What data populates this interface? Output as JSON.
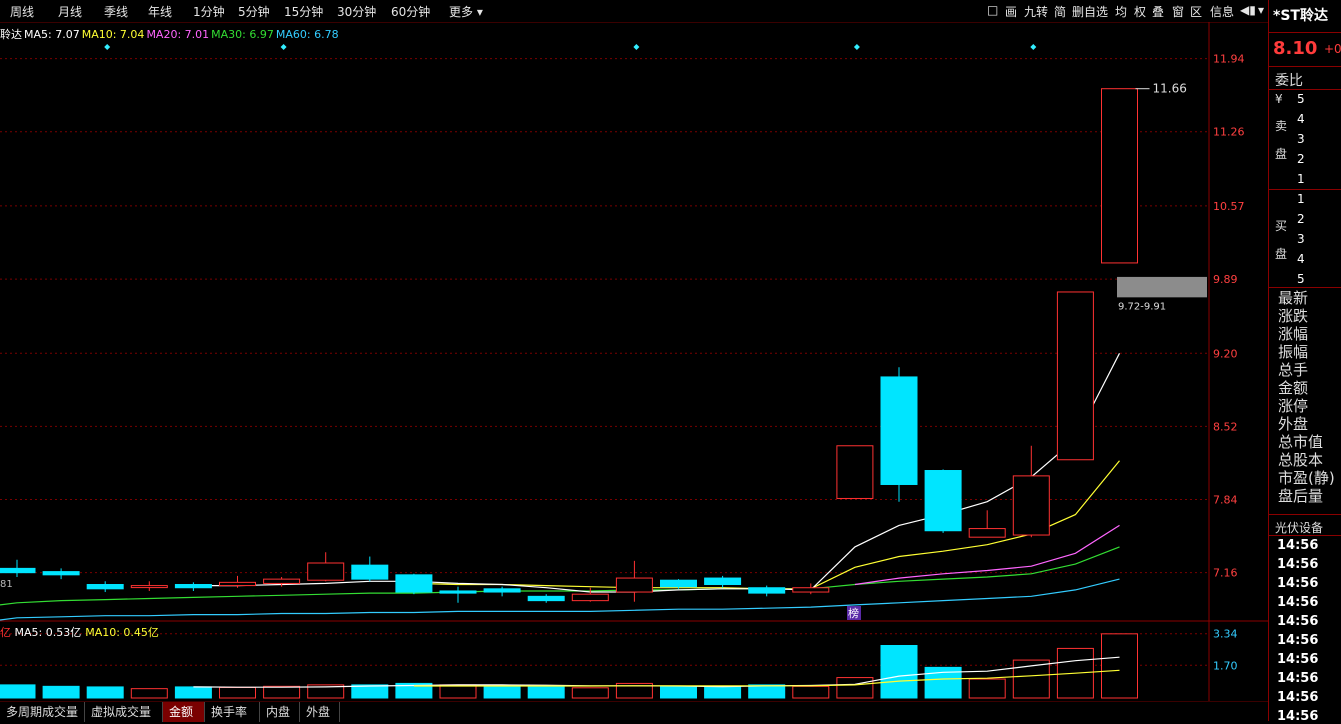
{
  "toolbar": {
    "periods": [
      "周线",
      "月线",
      "季线",
      "年线",
      "1分钟",
      "5分钟",
      "15分钟",
      "30分钟",
      "60分钟",
      "更多"
    ],
    "icons": [
      "□",
      "画",
      "九转",
      "简",
      "删自选",
      "均",
      "权",
      "叠",
      "窗",
      "区",
      "信息",
      "◀▮",
      "▾"
    ]
  },
  "ma_legend": {
    "name": "聆达",
    "items": [
      {
        "label": "MA5: 7.07",
        "color": "#ffffff"
      },
      {
        "label": "MA10: 7.04",
        "color": "#ffff33"
      },
      {
        "label": "MA20: 7.01",
        "color": "#ff66ff"
      },
      {
        "label": "MA30: 6.97",
        "color": "#33dd33"
      },
      {
        "label": "MA60: 6.78",
        "color": "#33ccff"
      }
    ]
  },
  "price_axis": {
    "ticks": [
      "11.94",
      "11.26",
      "10.57",
      "9.89",
      "9.20",
      "8.52",
      "7.84",
      "7.16"
    ]
  },
  "annotations": {
    "high_label": "11.66",
    "range_label": "9.72-9.91",
    "left_edge_label": "81",
    "bang_marker": "榜"
  },
  "volume": {
    "legend_prefix": "亿",
    "items": [
      {
        "label": "MA5: 0.53亿",
        "color": "#ffffff"
      },
      {
        "label": "MA10: 0.45亿",
        "color": "#ffff33"
      }
    ],
    "axis_ticks": [
      "3.34",
      "1.70"
    ]
  },
  "tabs": [
    {
      "label": "多周期成交量",
      "active": false
    },
    {
      "label": "虚拟成交量",
      "active": false
    },
    {
      "label": "金额",
      "active": true
    },
    {
      "label": "换手率",
      "active": false
    },
    {
      "label": "内盘",
      "active": false
    },
    {
      "label": "外盘",
      "active": false
    }
  ],
  "right_panel": {
    "title": "*ST聆达",
    "price": "8.10",
    "change": "+0",
    "weibi": "委比",
    "yen": "¥",
    "sell_chars": [
      "卖",
      "盘"
    ],
    "sell_levels": [
      "5",
      "4",
      "3",
      "2",
      "1"
    ],
    "buy_chars": [
      "买",
      "盘"
    ],
    "buy_levels": [
      "1",
      "2",
      "3",
      "4",
      "5"
    ],
    "fields": [
      "最新",
      "涨跌",
      "涨幅",
      "振幅",
      "总手",
      "金额",
      "涨停",
      "外盘",
      "总市值",
      "总股本",
      "市盈(静)",
      "盘后量"
    ],
    "sector": "光伏设备",
    "times": [
      "14:56",
      "14:56",
      "14:56",
      "14:56",
      "14:56",
      "14:56",
      "14:56",
      "14:56",
      "14:56",
      "14:56"
    ]
  },
  "chart_data": {
    "type": "candlestick",
    "colors": {
      "up": "#ff3232",
      "down": "#00e5ff",
      "ma5": "#ffffff",
      "ma10": "#ffff33",
      "ma20": "#ff66ff",
      "ma30": "#33dd33",
      "ma60": "#33ccff",
      "grid": "#7a0000"
    },
    "candles": [
      {
        "open": 7.2,
        "close": 7.16,
        "high": 7.28,
        "low": 7.12
      },
      {
        "open": 7.17,
        "close": 7.14,
        "high": 7.2,
        "low": 7.1
      },
      {
        "open": 7.05,
        "close": 7.01,
        "high": 7.08,
        "low": 6.98
      },
      {
        "open": 7.03,
        "close": 7.04,
        "high": 7.08,
        "low": 6.99
      },
      {
        "open": 7.05,
        "close": 7.02,
        "high": 7.07,
        "low": 6.99
      },
      {
        "open": 7.04,
        "close": 7.07,
        "high": 7.13,
        "low": 7.02
      },
      {
        "open": 7.06,
        "close": 7.1,
        "high": 7.12,
        "low": 7.03
      },
      {
        "open": 7.09,
        "close": 7.25,
        "high": 7.35,
        "low": 7.08
      },
      {
        "open": 7.23,
        "close": 7.1,
        "high": 7.31,
        "low": 7.08
      },
      {
        "open": 7.14,
        "close": 6.98,
        "high": 7.15,
        "low": 6.96
      },
      {
        "open": 6.99,
        "close": 6.97,
        "high": 7.03,
        "low": 6.88
      },
      {
        "open": 7.01,
        "close": 6.98,
        "high": 7.03,
        "low": 6.94
      },
      {
        "open": 6.94,
        "close": 6.9,
        "high": 6.96,
        "low": 6.88
      },
      {
        "open": 6.9,
        "close": 6.96,
        "high": 7.02,
        "low": 6.89
      },
      {
        "open": 6.98,
        "close": 7.11,
        "high": 7.27,
        "low": 6.89
      },
      {
        "open": 7.09,
        "close": 7.03,
        "high": 7.1,
        "low": 7.01
      },
      {
        "open": 7.11,
        "close": 7.05,
        "high": 7.13,
        "low": 7.02
      },
      {
        "open": 7.02,
        "close": 6.97,
        "high": 7.04,
        "low": 6.94
      },
      {
        "open": 6.98,
        "close": 7.02,
        "high": 7.06,
        "low": 6.96
      },
      {
        "open": 7.85,
        "close": 8.34,
        "high": 8.34,
        "low": 7.85
      },
      {
        "open": 8.98,
        "close": 7.98,
        "high": 9.07,
        "low": 7.82
      },
      {
        "open": 8.11,
        "close": 7.55,
        "high": 8.12,
        "low": 7.53
      },
      {
        "open": 7.49,
        "close": 7.57,
        "high": 7.74,
        "low": 7.49
      },
      {
        "open": 7.51,
        "close": 8.06,
        "high": 8.34,
        "low": 7.49
      },
      {
        "open": 8.21,
        "close": 9.77,
        "high": 9.77,
        "low": 8.21
      },
      {
        "open": 10.04,
        "close": 11.66,
        "high": 11.66,
        "low": 10.04
      }
    ],
    "ma": {
      "ma5": [
        null,
        null,
        null,
        null,
        7.04,
        7.04,
        7.05,
        7.06,
        7.08,
        7.08,
        7.06,
        7.05,
        7.02,
        6.98,
        6.98,
        7.0,
        7.01,
        7.01,
        7.0,
        7.4,
        7.6,
        7.7,
        7.82,
        8.05,
        8.4,
        9.2
      ],
      "ma10": [
        null,
        null,
        null,
        null,
        null,
        null,
        null,
        null,
        null,
        7.06,
        7.05,
        7.05,
        7.04,
        7.03,
        7.02,
        7.02,
        7.02,
        7.01,
        7.01,
        7.21,
        7.31,
        7.36,
        7.42,
        7.52,
        7.7,
        8.2
      ],
      "ma20": [
        null,
        null,
        null,
        null,
        null,
        null,
        null,
        null,
        null,
        null,
        null,
        null,
        null,
        null,
        null,
        null,
        null,
        null,
        null,
        7.05,
        7.11,
        7.15,
        7.18,
        7.22,
        7.34,
        7.6
      ],
      "ma30": [
        6.88,
        6.9,
        6.91,
        6.92,
        6.93,
        6.94,
        6.95,
        6.96,
        6.97,
        6.97,
        6.98,
        6.99,
        6.99,
        6.99,
        7.0,
        7.0,
        7.01,
        7.01,
        7.01,
        7.05,
        7.08,
        7.1,
        7.12,
        7.15,
        7.24,
        7.4
      ],
      "ma60": [
        6.74,
        6.75,
        6.76,
        6.76,
        6.77,
        6.77,
        6.78,
        6.78,
        6.79,
        6.79,
        6.8,
        6.8,
        6.8,
        6.8,
        6.81,
        6.82,
        6.82,
        6.83,
        6.84,
        6.86,
        6.88,
        6.9,
        6.92,
        6.94,
        7.0,
        7.1
      ]
    },
    "price_range": [
      6.72,
      12.15
    ],
    "volume": [
      0.45,
      0.4,
      0.38,
      0.32,
      0.38,
      0.36,
      0.4,
      0.45,
      0.45,
      0.5,
      0.45,
      0.4,
      0.4,
      0.35,
      0.5,
      0.4,
      0.4,
      0.45,
      0.4,
      0.7,
      1.8,
      1.05,
      0.65,
      1.3,
      1.7,
      2.2
    ],
    "volume_up": [
      false,
      false,
      false,
      true,
      false,
      true,
      true,
      true,
      false,
      false,
      true,
      false,
      false,
      true,
      true,
      false,
      false,
      false,
      true,
      true,
      false,
      false,
      true,
      true,
      true,
      true
    ],
    "vol_ma5": [
      null,
      null,
      null,
      null,
      0.38,
      0.37,
      0.37,
      0.38,
      0.41,
      0.43,
      0.45,
      0.45,
      0.44,
      0.42,
      0.42,
      0.41,
      0.39,
      0.42,
      0.43,
      0.47,
      0.75,
      0.88,
      0.92,
      1.1,
      1.28,
      1.4
    ],
    "vol_ma10": [
      null,
      null,
      null,
      null,
      null,
      null,
      null,
      null,
      null,
      0.41,
      0.41,
      0.41,
      0.41,
      0.41,
      0.42,
      0.42,
      0.42,
      0.42,
      0.42,
      0.45,
      0.58,
      0.65,
      0.68,
      0.76,
      0.85,
      0.95
    ],
    "volume_range": [
      0,
      2.4
    ],
    "markers_at": [
      2,
      6,
      14,
      19,
      23
    ]
  }
}
